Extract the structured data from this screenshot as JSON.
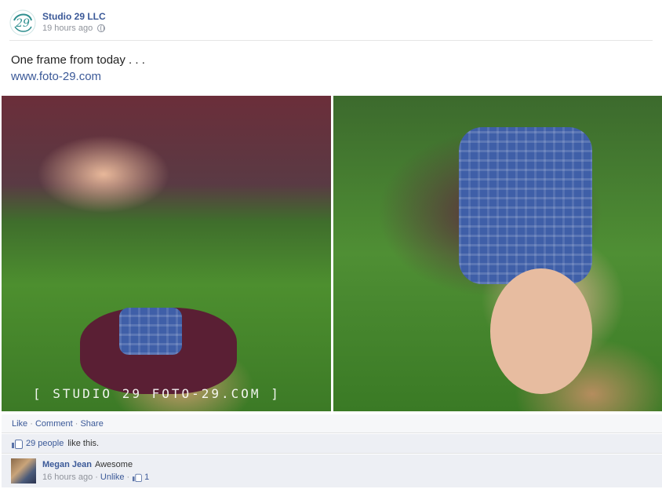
{
  "post": {
    "page_name": "Studio 29 LLC",
    "time": "19 hours ago",
    "status_text": "One frame from today . . .",
    "link_text": "www.foto-29.com",
    "watermark": "[ STUDIO 29 FOTO-29.COM ]",
    "logo_text": "29"
  },
  "actions": {
    "like": "Like",
    "sep": "·",
    "comment": "Comment",
    "share": "Share"
  },
  "likes": {
    "count_link": "29 people",
    "suffix": "like this."
  },
  "comment": {
    "author": "Megan Jean",
    "text": "Awesome",
    "time": "16 hours ago",
    "unlike": "Unlike",
    "like_count": "1"
  },
  "colors": {
    "link_blue": "#3b5998",
    "meta_gray": "#90949c",
    "logo_teal": "#2f8f8f"
  }
}
